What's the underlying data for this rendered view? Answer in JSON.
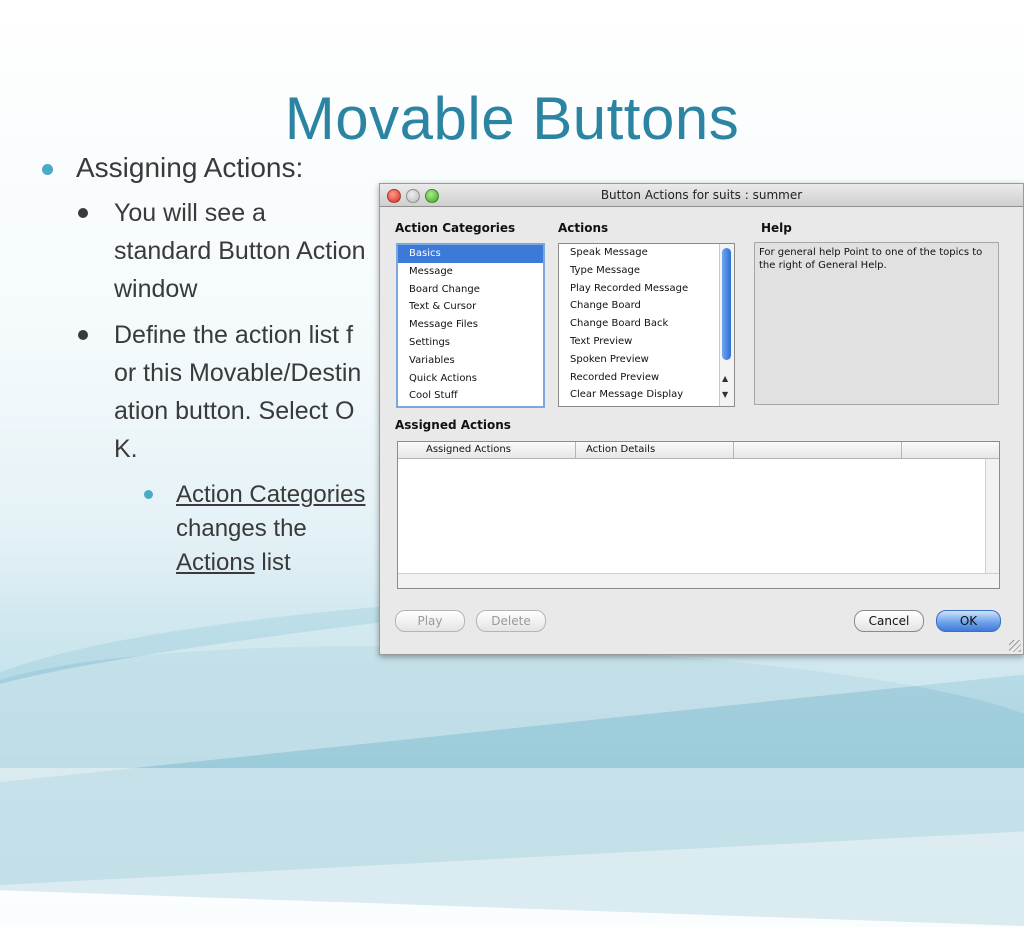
{
  "slide": {
    "title": "Movable Buttons",
    "bullet_1": "Assigning Actions:",
    "bullet_1_1": "You will see a standard Button Action window",
    "bullet_1_2": "Define the action list for this Movable/Destination button.  Select OK.",
    "bullet_1_2_1": {
      "link_1": "Action Categories",
      "text_1": " changes the ",
      "link_2": "Actions",
      "text_2": " list"
    }
  },
  "window": {
    "title": "Button Actions for suits : summer",
    "action_categories_label": "Action Categories",
    "actions_label": "Actions",
    "help_label": "Help",
    "categories": [
      "Basics",
      "Message",
      "Board Change",
      "Text & Cursor",
      "Message Files",
      "Settings",
      "Variables",
      "Quick Actions",
      "Cool Stuff"
    ],
    "selected_category": "Basics",
    "actions": [
      "Speak Message",
      "Type Message",
      "Play Recorded Message",
      "Change Board",
      "Change Board Back",
      "Text Preview",
      "Spoken Preview",
      "Recorded Preview",
      "Clear Message Display"
    ],
    "help_text": "For general help Point to one of the topics to the right of General Help.",
    "assigned_actions_label": "Assigned Actions",
    "table_columns": [
      "Assigned Actions",
      "Action Details",
      "",
      ""
    ],
    "buttons": {
      "play": "Play",
      "delete": "Delete",
      "cancel": "Cancel",
      "ok": "OK"
    }
  },
  "colors": {
    "title": "#2a84a2",
    "bullet_accent": "#4ba9c8",
    "selection": "#3d79d6"
  },
  "icons": {
    "close": "red-traffic-light",
    "minimize": "yellow-traffic-light",
    "zoom": "green-traffic-light",
    "scroll_up": "up-arrow",
    "scroll_down": "down-arrow",
    "resize": "resize-grip"
  }
}
